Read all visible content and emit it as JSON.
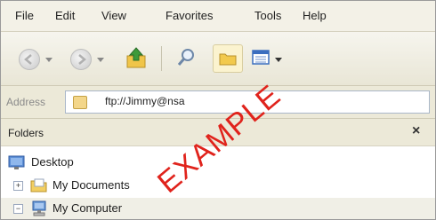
{
  "menu": {
    "items": [
      "File",
      "Edit",
      "View",
      "Favorites",
      "Tools",
      "Help"
    ]
  },
  "toolbar": {
    "buttons": [
      {
        "name": "back",
        "icon": "back-arrow-icon"
      },
      {
        "name": "forward",
        "icon": "forward-arrow-icon"
      },
      {
        "name": "up",
        "icon": "up-folder-icon"
      },
      {
        "name": "search",
        "icon": "search-icon"
      },
      {
        "name": "folders",
        "icon": "folders-icon"
      },
      {
        "name": "views",
        "icon": "views-icon"
      }
    ]
  },
  "address": {
    "label": "Address",
    "value": "ftp://Jimmy@nsa"
  },
  "folders_pane": {
    "title": "Folders",
    "close_glyph": "×",
    "tree": [
      {
        "label": "Desktop",
        "icon": "desktop-icon"
      },
      {
        "label": "My Documents",
        "icon": "folder-icon",
        "expander": "+"
      },
      {
        "label": "My Computer",
        "icon": "computer-icon",
        "expander": "−"
      }
    ]
  },
  "watermark": "EXAMPLE",
  "colors": {
    "watermark": "#e0231c",
    "chrome": "#ece9d8",
    "highlight": "#fbf3cf"
  }
}
